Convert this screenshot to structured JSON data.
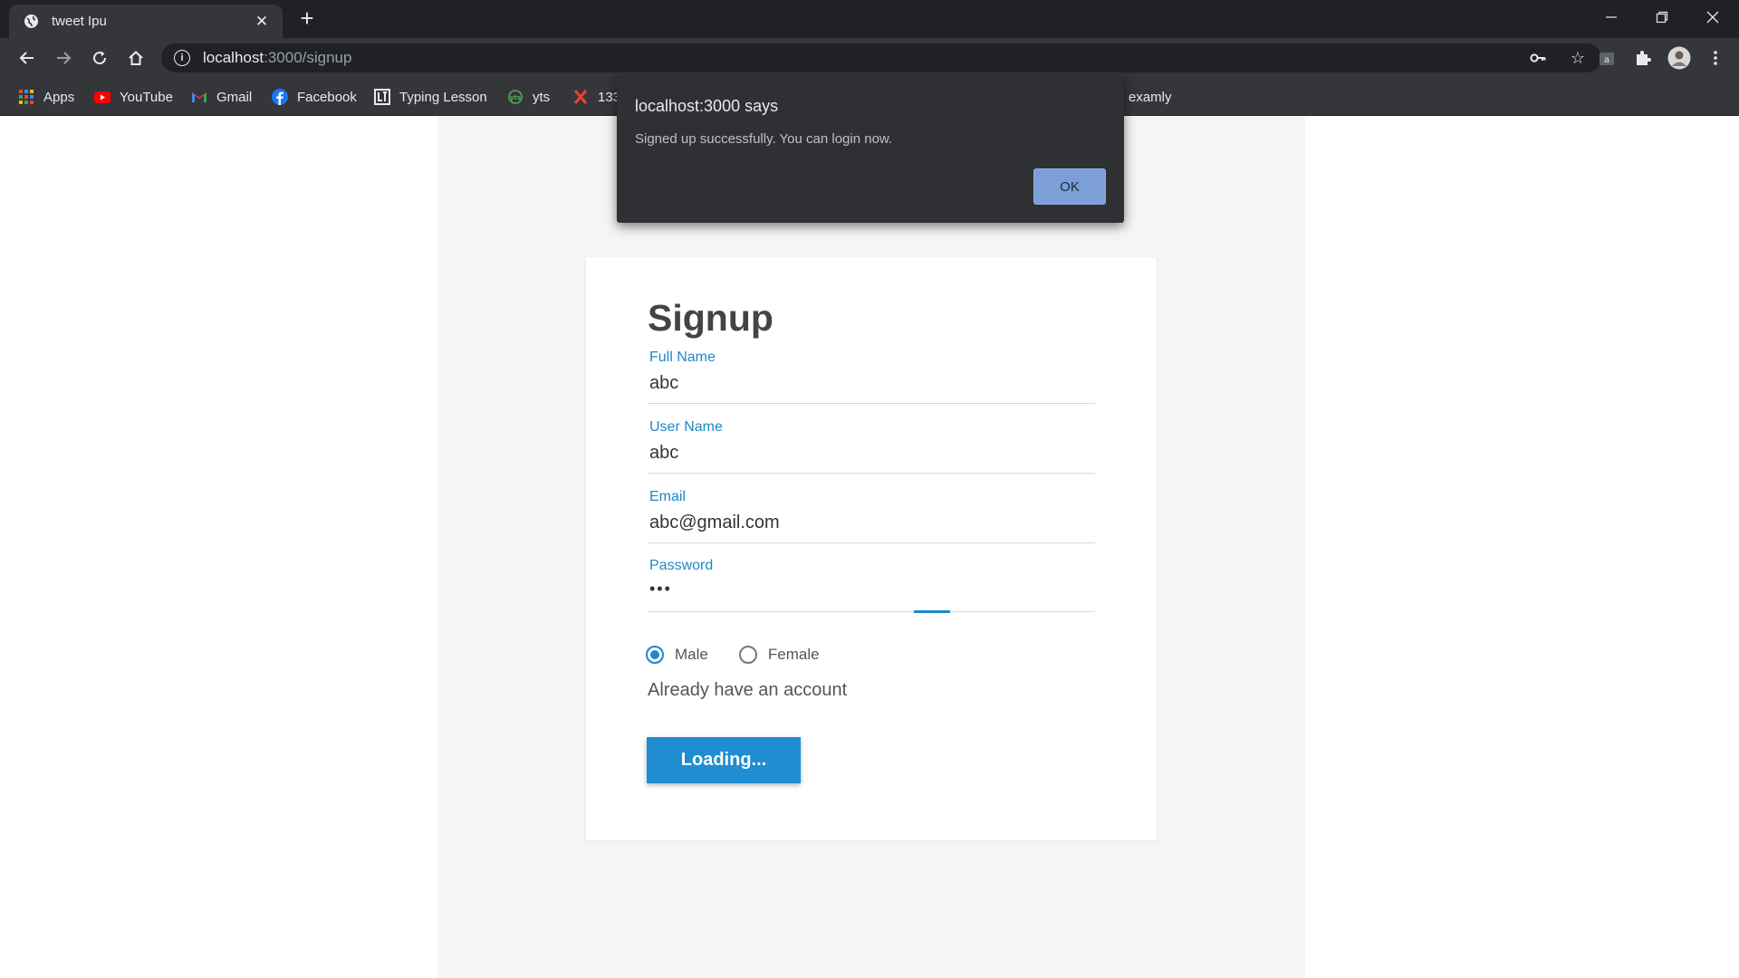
{
  "browser": {
    "tab_title": "tweet Ipu",
    "tab_close": "✕",
    "new_tab": "+",
    "url_host": "localhost",
    "url_path": ":3000/signup",
    "bookmarks": [
      {
        "label": "Apps",
        "icon": "apps-grid-icon"
      },
      {
        "label": "YouTube",
        "icon": "youtube-icon"
      },
      {
        "label": "Gmail",
        "icon": "gmail-icon"
      },
      {
        "label": "Facebook",
        "icon": "facebook-icon"
      },
      {
        "label": "Typing Lesson",
        "icon": "typing-lesson-icon"
      },
      {
        "label": "yts",
        "icon": "yts-icon"
      },
      {
        "label": "133",
        "icon": "x-logo-icon"
      },
      {
        "label": "examly",
        "icon": ""
      }
    ]
  },
  "dialog": {
    "title": "localhost:3000 says",
    "message": "Signed up successfully. You can login now.",
    "ok_label": "OK"
  },
  "form": {
    "title": "Signup",
    "full_name": {
      "label": "Full Name",
      "value": "abc"
    },
    "user_name": {
      "label": "User Name",
      "value": "abc"
    },
    "email": {
      "label": "Email",
      "value": "abc@gmail.com"
    },
    "password": {
      "label": "Password",
      "value": "•••"
    },
    "gender": {
      "options": [
        "Male",
        "Female"
      ],
      "selected": "Male"
    },
    "already_account": "Already have an account",
    "submit_label": "Loading..."
  },
  "colors": {
    "accent": "#1e88c7",
    "button": "#1e8dd2",
    "chrome_dark": "#202124",
    "chrome_bar": "#35363a",
    "dialog_bg": "#2f3033",
    "dialog_button": "#7b9fd6"
  }
}
